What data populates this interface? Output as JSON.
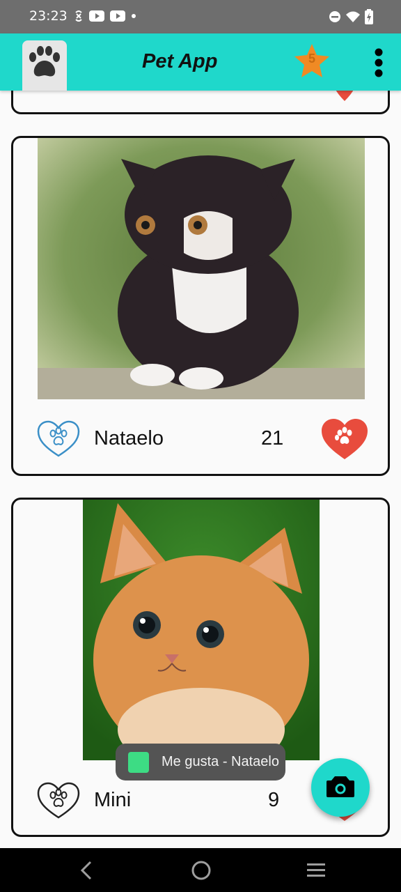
{
  "status_bar": {
    "time": "23:23",
    "left_icons": [
      "vpn-icon",
      "youtube-icon",
      "youtube-icon",
      "dot-icon"
    ],
    "right_icons": [
      "do-not-disturb-icon",
      "wifi-icon",
      "battery-charging-icon"
    ]
  },
  "toolbar": {
    "title": "Pet App",
    "logo_icon": "paw-icon",
    "star_count": "5",
    "menu_icon": "more-vert-icon",
    "colors": {
      "background": "#1fd8cb",
      "star": "#f08a24"
    }
  },
  "pets": [
    {
      "name": "Nataelo",
      "likes": "21"
    }
  ],
  "cards": [
    {
      "name": "Nataelo",
      "likes": "21"
    },
    {
      "name": "Mini",
      "likes": "9"
    }
  ],
  "toast": {
    "text": "Me gusta - Nataelo"
  },
  "fab": {
    "icon": "camera-icon",
    "color": "#1fd8cb"
  },
  "nav_bar": {
    "icons": [
      "back-icon",
      "home-icon",
      "recents-icon"
    ]
  }
}
